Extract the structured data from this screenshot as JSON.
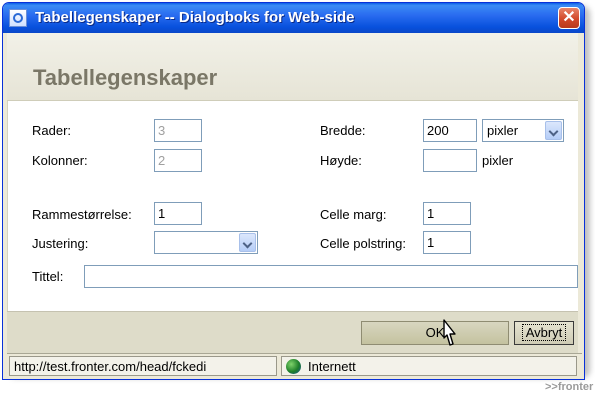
{
  "window": {
    "title": "Tabellegenskaper -- Dialogboks for Web-side",
    "close": "✕"
  },
  "header": {
    "title": "Tabellegenskaper"
  },
  "form": {
    "rows": {
      "label": "Rader:",
      "value": "3"
    },
    "columns": {
      "label": "Kolonner:",
      "value": "2"
    },
    "border_size": {
      "label": "Rammestørrelse:",
      "value": "1"
    },
    "alignment": {
      "label": "Justering:",
      "value": ""
    },
    "width": {
      "label": "Bredde:",
      "value": "200",
      "unit": "pixler"
    },
    "height": {
      "label": "Høyde:",
      "value": "",
      "unit": "pixler"
    },
    "cell_spacing": {
      "label": "Celle marg:",
      "value": "1"
    },
    "cell_padding": {
      "label": "Celle polstring:",
      "value": "1"
    },
    "caption": {
      "label": "Tittel:",
      "value": ""
    }
  },
  "buttons": {
    "ok": "OK",
    "cancel": "Avbryt"
  },
  "status": {
    "url": "http://test.fronter.com/head/fckedi",
    "zone": "Internett"
  },
  "watermark": ">>fronter"
}
